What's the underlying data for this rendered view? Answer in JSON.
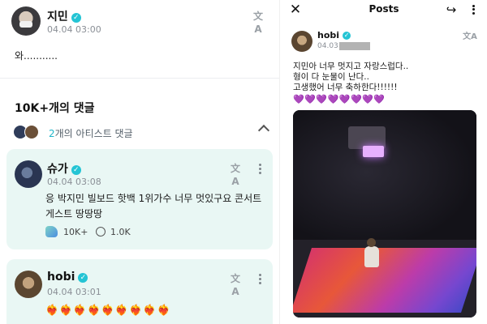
{
  "left_post": {
    "author": "지민",
    "timestamp": "04.04 03:00",
    "text": "와..........."
  },
  "comments_section": {
    "title": "10K+개의 댓글",
    "artist_count": "2",
    "artist_label": "개의 아티스트 댓글"
  },
  "comments": [
    {
      "author": "슈가",
      "timestamp": "04.04 03:08",
      "text": "응 박지민 빌보드 핫백 1위가수 너무 멋있구요 콘서트 게스트 땅땅땅",
      "likes": "10K+",
      "replies": "1.0K"
    },
    {
      "author": "hobi",
      "timestamp": "04.04 03:01",
      "text": "❤️‍🔥❤️‍🔥❤️‍🔥❤️‍🔥❤️‍🔥❤️‍🔥❤️‍🔥❤️‍🔥❤️‍🔥"
    }
  ],
  "right_view": {
    "title": "Posts",
    "author": "hobi",
    "timestamp_prefix": "04.03",
    "lines": [
      "지민아 너무 멋지고 자랑스럽다..",
      "형이 다 눈물이 난다..",
      "고생했어 너무 축하한다!!!!!!"
    ],
    "hearts": "💜💜💜💜💜💜💜💜"
  },
  "colors": {
    "verified": "#24c4d4",
    "card_bg": "#e9f7f4",
    "accent_count": "#1fb5c9"
  },
  "icons": {
    "translate": "文A",
    "close": "✕",
    "share": "↪",
    "verified": "✓"
  }
}
